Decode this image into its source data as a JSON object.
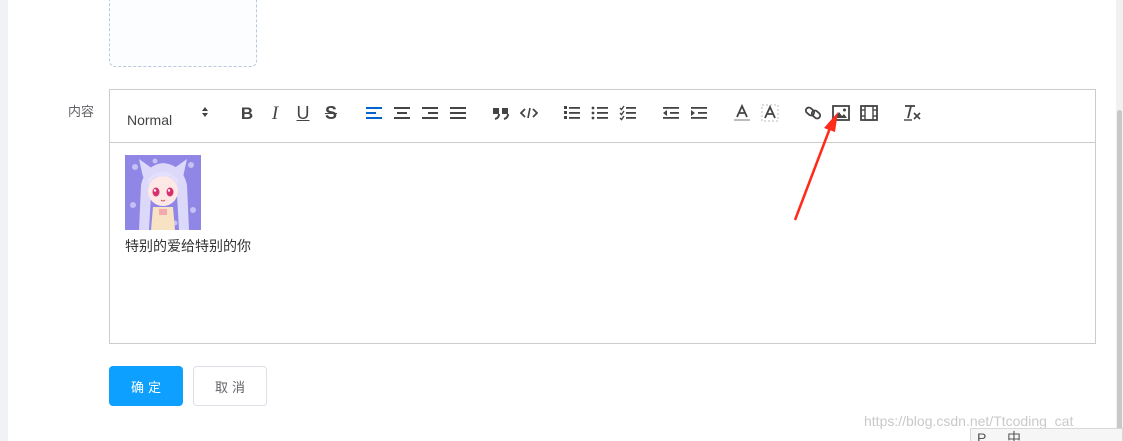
{
  "form": {
    "content_label": "内容"
  },
  "toolbar": {
    "header_value": "Normal",
    "buttons": [
      {
        "name": "bold-button",
        "icon": "bold-icon",
        "glyph": "B"
      },
      {
        "name": "italic-button",
        "icon": "italic-icon",
        "glyph": "I"
      },
      {
        "name": "underline-button",
        "icon": "underline-icon",
        "glyph": "U"
      },
      {
        "name": "strike-button",
        "icon": "strike-icon",
        "glyph": "S"
      }
    ]
  },
  "editor": {
    "text": "特别的爱给特别的你",
    "image_alt": "anime-avatar"
  },
  "actions": {
    "confirm_label": "确定",
    "cancel_label": "取消"
  },
  "watermark": "https://blog.csdn.net/Ttcoding_cat",
  "ime": {
    "items": [
      "P",
      "中"
    ]
  },
  "colors": {
    "primary": "#0ea0ff",
    "active_align": "#0066cc",
    "arrow": "#ff2a1a"
  }
}
